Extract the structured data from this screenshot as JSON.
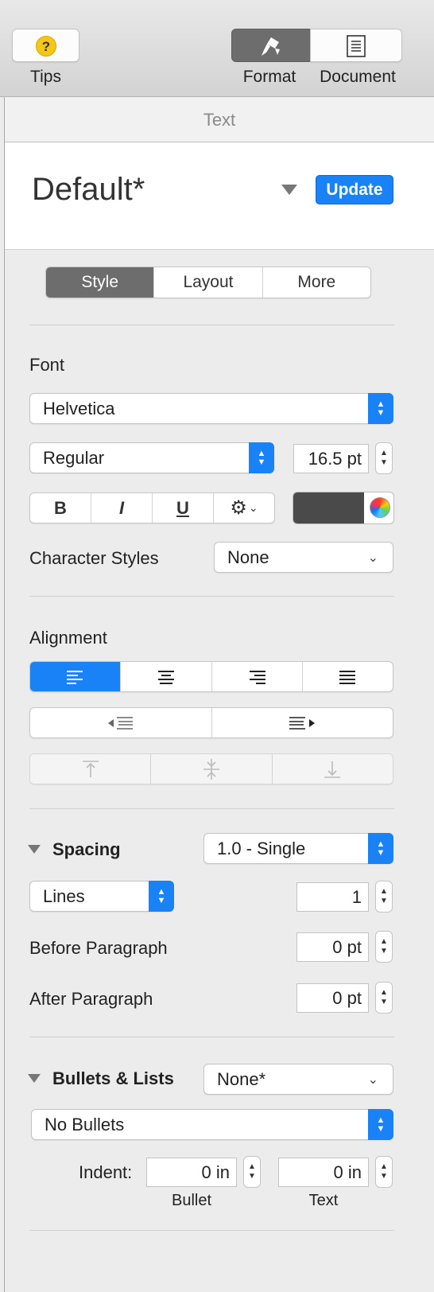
{
  "toolbar": {
    "tips_label": "Tips",
    "format_label": "Format",
    "document_label": "Document"
  },
  "panel_title": "Text",
  "paragraph_style": {
    "name": "Default*",
    "update_label": "Update"
  },
  "tabs": {
    "style": "Style",
    "layout": "Layout",
    "more": "More",
    "active": "Style"
  },
  "font": {
    "section_label": "Font",
    "family": "Helvetica",
    "typeface": "Regular",
    "size": "16.5 pt",
    "bold_label": "B",
    "italic_label": "I",
    "underline_label": "U",
    "text_color": "#4a4a4a",
    "character_styles_label": "Character Styles",
    "character_style_value": "None"
  },
  "alignment": {
    "section_label": "Alignment",
    "selected": "left"
  },
  "spacing": {
    "section_label": "Spacing",
    "preset": "1.0 - Single",
    "mode": "Lines",
    "lines_value": "1",
    "before_label": "Before Paragraph",
    "before_value": "0 pt",
    "after_label": "After Paragraph",
    "after_value": "0 pt"
  },
  "bullets": {
    "section_label": "Bullets & Lists",
    "preset": "None*",
    "type": "No Bullets",
    "indent_label": "Indent:",
    "bullet_indent": "0 in",
    "text_indent": "0 in",
    "bullet_caption": "Bullet",
    "text_caption": "Text"
  },
  "colors": {
    "accent": "#1a82f7",
    "segment_active": "#6d6d6d"
  }
}
